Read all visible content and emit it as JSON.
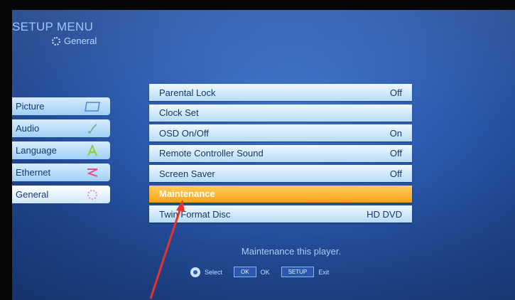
{
  "header": {
    "title": "SETUP MENU",
    "subtitle": "General"
  },
  "sidebar": {
    "items": [
      {
        "label": "Picture",
        "icon": "picture-frame-icon"
      },
      {
        "label": "Audio",
        "icon": "music-note-icon"
      },
      {
        "label": "Language",
        "icon": "letter-a-icon"
      },
      {
        "label": "Ethernet",
        "icon": "network-zigzag-icon"
      },
      {
        "label": "General",
        "icon": "gear-dots-icon"
      }
    ]
  },
  "settings": {
    "items": [
      {
        "label": "Parental Lock",
        "value": "Off"
      },
      {
        "label": "Clock Set",
        "value": ""
      },
      {
        "label": "OSD On/Off",
        "value": "On"
      },
      {
        "label": "Remote Controller Sound",
        "value": "Off"
      },
      {
        "label": "Screen Saver",
        "value": "Off"
      },
      {
        "label": "Maintenance",
        "value": ""
      },
      {
        "label": "Twin Format Disc",
        "value": "HD DVD"
      }
    ]
  },
  "description": "Maintenance this player.",
  "help": {
    "select": "Select",
    "ok_key": "OK",
    "ok_label": "OK",
    "setup_key": "SETUP",
    "exit_label": "Exit"
  },
  "colors": {
    "highlight": "#f7a11b",
    "accent_arrow": "#e8322a"
  }
}
